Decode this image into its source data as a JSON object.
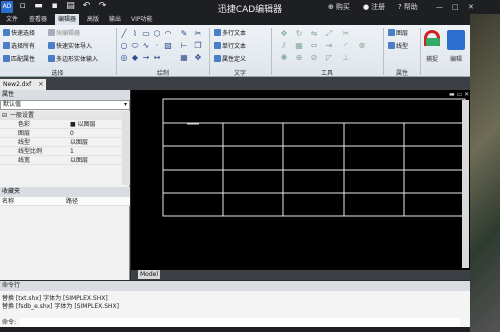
{
  "window": {
    "title": "迅捷CAD编辑器",
    "logo": "AD",
    "buy": "购买",
    "register": "注册",
    "help": "帮助"
  },
  "menus": [
    "文件",
    "查看器",
    "编辑器",
    "高版",
    "输出",
    "VIP功能"
  ],
  "ribbon": {
    "select": {
      "quick_select": "快速选择",
      "select_all": "选择所有",
      "match_props": "匹配属性",
      "block_editor": "块编辑器",
      "quick_entity_import": "快速实体导入",
      "polygon_entity_input": "多边形实体输入",
      "label": "选择"
    },
    "draw": {
      "label": "绘制"
    },
    "text": {
      "mtext": "多行文本",
      "stext": "单行文本",
      "attdef": "属性定义",
      "label": "文字"
    },
    "tools": {
      "label": "工具"
    },
    "props": {
      "layer": "图层",
      "linetype": "线型",
      "label": "属性"
    },
    "capture": "捕捉",
    "edit": "编辑"
  },
  "doc_tab": "New2.dxf",
  "properties": {
    "header": "属性",
    "selector": "默认值",
    "section": "一般设置",
    "rows": [
      {
        "k": "色彩",
        "v": "■ 以图层"
      },
      {
        "k": "图层",
        "v": "0"
      },
      {
        "k": "线型",
        "v": "以图层"
      },
      {
        "k": "线型比例",
        "v": "1"
      },
      {
        "k": "线宽",
        "v": "以图层"
      }
    ]
  },
  "favorites": {
    "header": "收藏夹",
    "col_name": "名称",
    "col_path": "路径"
  },
  "model_tab": "Model",
  "command": {
    "header": "命令行",
    "lines": [
      "替换 [txt.shx] 字体为 [SIMPLEX.SHX]",
      "替换 [fsdb_e.shx] 字体为 [SIMPLEX.SHX]"
    ],
    "prompt": "命令:"
  },
  "colors": {
    "accent": "#2a6fd0",
    "ribbon_bg": "#e6ebf0",
    "viewport": "#000000"
  }
}
